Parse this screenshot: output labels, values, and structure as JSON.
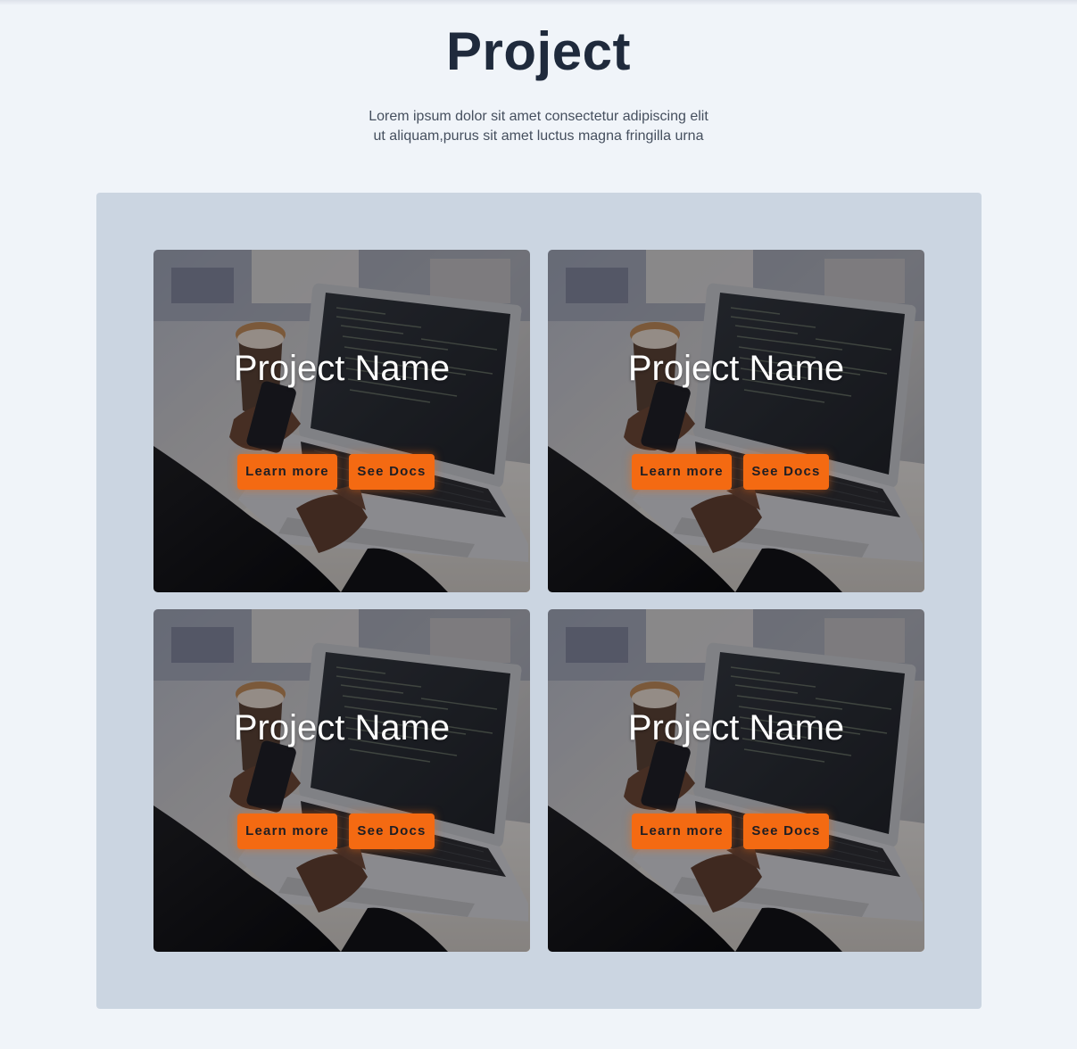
{
  "header": {
    "title": "Project",
    "subtitle_line1": "Lorem ipsum dolor sit amet consectetur adipiscing elit",
    "subtitle_line2": "ut aliquam,purus sit amet luctus magna fringilla urna"
  },
  "projects": [
    {
      "name": "Project Name",
      "learn_label": "Learn more",
      "docs_label": "See Docs"
    },
    {
      "name": "Project Name",
      "learn_label": "Learn more",
      "docs_label": "See Docs"
    },
    {
      "name": "Project Name",
      "learn_label": "Learn more",
      "docs_label": "See Docs"
    },
    {
      "name": "Project Name",
      "learn_label": "Learn more",
      "docs_label": "See Docs"
    }
  ],
  "colors": {
    "page_background": "#f0f4f9",
    "gallery_background": "#cbd5e1",
    "title_text": "#1f2a3c",
    "button_accent": "#f46a12"
  },
  "icons": {
    "card_image": "laptop-photo"
  }
}
